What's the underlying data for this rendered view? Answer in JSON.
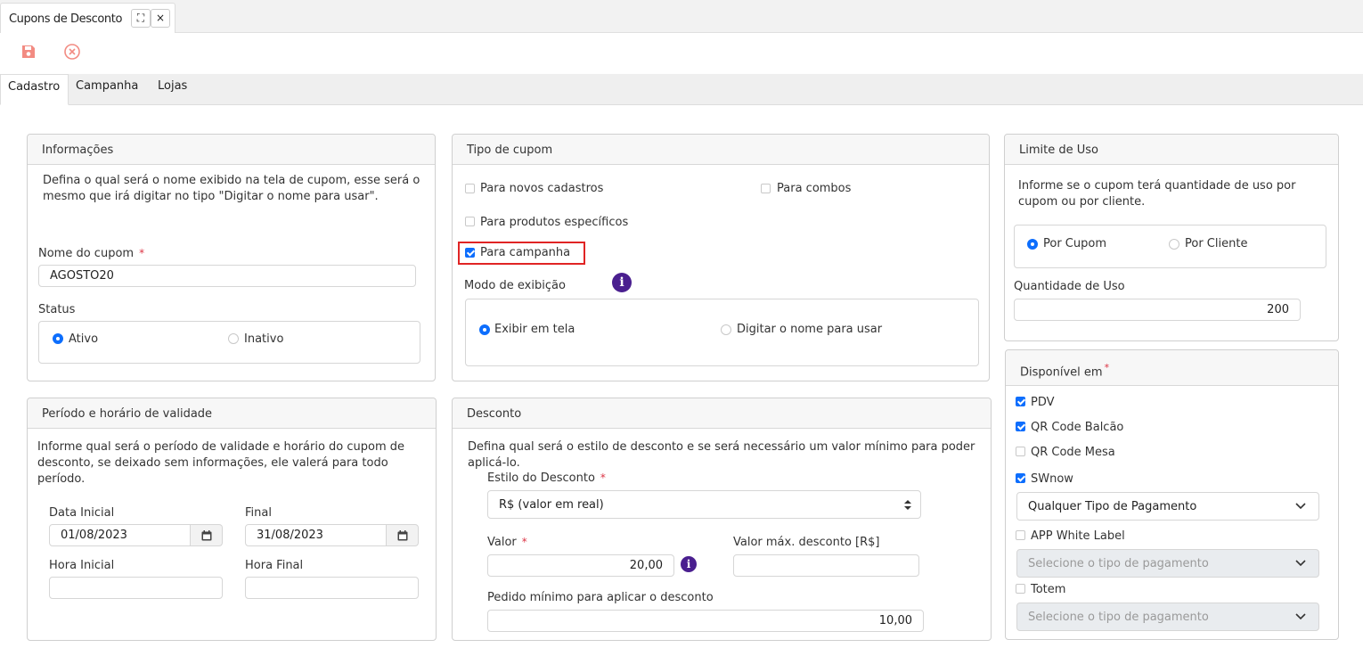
{
  "window": {
    "tab_title": "Cupons de Desconto",
    "expand_glyph": "⛶",
    "close_glyph": "×"
  },
  "toolbar": {
    "save_icon": "save-icon",
    "cancel_icon": "cancel-circle-icon"
  },
  "subtabs": [
    {
      "label": "Cadastro",
      "active": true
    },
    {
      "label": "Campanha",
      "active": false
    },
    {
      "label": "Lojas",
      "active": false
    }
  ],
  "informacoes": {
    "title": "Informações",
    "description": "Defina o qual será o nome exibido na tela de cupom, esse será o mesmo que irá digitar no tipo \"Digitar o nome para usar\".",
    "name_label": "Nome do cupom",
    "required_mark": "*",
    "name_value": "AGOSTO20",
    "status_label": "Status",
    "status_options": [
      {
        "label": "Ativo",
        "selected": true
      },
      {
        "label": "Inativo",
        "selected": false
      }
    ]
  },
  "tipo_cupom": {
    "title": "Tipo de cupom",
    "options": [
      {
        "label": "Para novos cadastros",
        "checked": false
      },
      {
        "label": "Para combos",
        "checked": false
      },
      {
        "label": "Para produtos específicos",
        "checked": false
      },
      {
        "label": "Para campanha",
        "checked": true
      }
    ],
    "modo_label": "Modo de exibição",
    "info_glyph": "i",
    "modo_options": [
      {
        "label": "Exibir em tela",
        "selected": true
      },
      {
        "label": "Digitar o nome para usar",
        "selected": false
      }
    ]
  },
  "limite_uso": {
    "title": "Limite de Uso",
    "description": "Informe se o cupom terá quantidade de uso por cupom ou por cliente.",
    "options": [
      {
        "label": "Por Cupom",
        "selected": true
      },
      {
        "label": "Por Cliente",
        "selected": false
      }
    ],
    "quantity_label": "Quantidade de Uso",
    "quantity_value": "200"
  },
  "periodo": {
    "title": "Período e horário de validade",
    "description": "Informe qual será o período de validade e horário do cupom de desconto, se deixado sem informações, ele valerá para todo período.",
    "start_date_label": "Data Inicial",
    "start_date_value": "01/08/2023",
    "end_date_label": "Final",
    "end_date_value": "31/08/2023",
    "start_time_label": "Hora Inicial",
    "start_time_value": "",
    "end_time_label": "Hora Final",
    "end_time_value": ""
  },
  "desconto": {
    "title": "Desconto",
    "description": "Defina qual será o estilo de desconto e se será necessário um valor mínimo para poder aplicá-lo.",
    "style_label": "Estilo do Desconto",
    "required_mark": "*",
    "style_value": "R$ (valor em real)",
    "value_label": "Valor",
    "value_value": "20,00",
    "info_glyph": "i",
    "max_label": "Valor máx. desconto [R$]",
    "max_value": "",
    "min_order_label": "Pedido mínimo para aplicar o desconto",
    "min_order_value": "10,00"
  },
  "disponivel": {
    "title": "Disponível em",
    "required_mark": "*",
    "channels": [
      {
        "label": "PDV",
        "checked": true
      },
      {
        "label": "QR Code Balcão",
        "checked": true
      },
      {
        "label": "QR Code Mesa",
        "checked": false
      },
      {
        "label": "SWnow",
        "checked": true
      },
      {
        "label": "APP White Label",
        "checked": false
      },
      {
        "label": "Totem",
        "checked": false
      }
    ],
    "swnow_payment": "Qualquer Tipo de Pagamento",
    "app_payment_placeholder": "Selecione o tipo de pagamento",
    "totem_payment_placeholder": "Selecione o tipo de pagamento"
  },
  "colors": {
    "accent": "#0d6efd",
    "required": "#dc3545",
    "highlight": "#e02424",
    "info": "#4a1f8f",
    "save_icon": "#f28b82"
  }
}
